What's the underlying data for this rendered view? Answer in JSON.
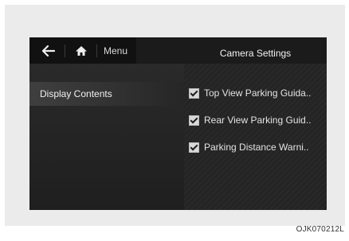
{
  "header": {
    "menu_label": "Menu",
    "title": "Camera Settings"
  },
  "sidebar": {
    "items": [
      {
        "label": "Display Contents"
      }
    ]
  },
  "options": [
    {
      "label": "Top View Parking Guida..",
      "checked": true
    },
    {
      "label": "Rear View Parking Guid..",
      "checked": true
    },
    {
      "label": "Parking Distance Warni..",
      "checked": true
    }
  ],
  "icons": {
    "back": "back-arrow-icon",
    "home": "home-icon",
    "checkbox": "checkbox-checked-icon"
  },
  "image_code": "OJK070212L"
}
